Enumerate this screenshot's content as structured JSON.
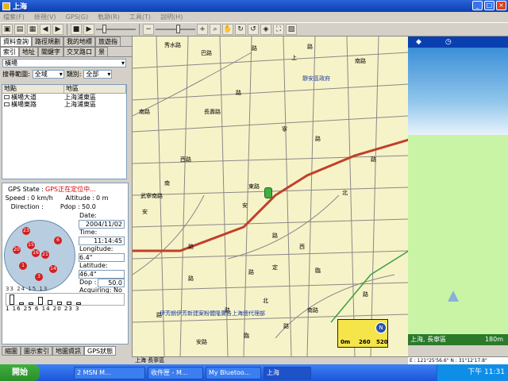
{
  "window": {
    "title": "上海"
  },
  "menu": [
    "檔案(F)",
    "檢視(V)",
    "GPS(G)",
    "軌跡(R)",
    "工具(T)",
    "說明(H)"
  ],
  "toolbar_icons": [
    "open-icon",
    "save-icon",
    "print-icon",
    "back-icon",
    "forward-icon",
    "stop-icon",
    "play-icon",
    "zoom-out-icon",
    "zoom-in-icon",
    "search-icon",
    "hand-icon",
    "rotate-icon"
  ],
  "left": {
    "tabs_top": [
      "資料查詢",
      "路徑規劃",
      "我的地標",
      "旅遊指"
    ],
    "tabs_sub": [
      "索引",
      "地址",
      "關鍵字",
      "交叉路口",
      "景"
    ],
    "category_select": "橫場",
    "search_range_label": "搜尋範圍:",
    "search_range_value": "全域",
    "type_label": "類別:",
    "type_value": "全部",
    "list_columns": [
      "地點",
      "地區"
    ],
    "list_rows": [
      {
        "name": "橫場大道",
        "area": "上海浦東區"
      },
      {
        "name": "橫場東路",
        "area": "上海浦東區"
      }
    ]
  },
  "gps": {
    "state_label": "GPS State :",
    "state_value": "GPS正在定位中...",
    "speed_label": "Speed :",
    "speed_value": "0 km/h",
    "altitude_label": "Altitude :",
    "altitude_value": "0 m",
    "direction_label": "Direction :",
    "pdop_label": "Pdop :",
    "pdop_value": "50.0",
    "date_label": "Date:",
    "date_value": "2004/11/02",
    "time_label": "Time:",
    "time_value": "11:14:45",
    "longitude_label": "Longitude:",
    "longitude_value": "6.4\"",
    "latitude_label": "Latitude:",
    "latitude_value": "46.4\"",
    "dop_label": "Dop :",
    "dop_value": "50.0",
    "acquiring_label": "Acquiring: No",
    "satellites": [
      "23",
      "6",
      "20",
      "16",
      "21",
      "15",
      "14",
      "3",
      "1"
    ],
    "bar_top_nums": "33 24   15   13",
    "bar_bottom_nums": "1 16 25  6 14 20 23  3",
    "signal_levels": [
      0.9,
      0.2,
      0.2,
      0.7,
      0.4,
      0.3,
      0.3,
      0.2
    ]
  },
  "bottom_tabs": [
    "縮圖",
    "圖示索引",
    "地圖資訊",
    "GPS狀態"
  ],
  "map": {
    "road_labels": [
      "秀水路",
      "巴路",
      "路",
      "路",
      "南路",
      "上",
      "南路",
      "長壽路",
      "武寧南路",
      "西路",
      "安",
      "路",
      "北",
      "路",
      "南",
      "臨",
      "路",
      "寧",
      "路",
      "東路",
      "定",
      "路",
      "路",
      "西",
      "路",
      "北",
      "路",
      "南路",
      "安",
      "路",
      "安路",
      "路",
      "臨",
      "路",
      "路",
      "巷",
      "寧",
      "路",
      "南路",
      "西路",
      "宜",
      "路",
      "北路",
      "臨",
      "路",
      "東路",
      "南",
      "路",
      "安",
      "路",
      "路",
      "中路",
      "寧",
      "路",
      "北",
      "路",
      "南",
      "路",
      "路",
      "中寧路",
      "湖南路",
      "安",
      "路",
      "路",
      "東路",
      "寧",
      "路",
      "路",
      "東路",
      "東",
      "路",
      "南",
      "路",
      "東路"
    ],
    "poi_labels": [
      "靜安區政府",
      "伊芳朗伊芳新建案粉體隆廣告上海總代理部"
    ],
    "scale_labels": [
      "0m",
      "260",
      "520"
    ],
    "status": "上海 長寧區"
  },
  "right": {
    "road_name": "上海, 長寧區",
    "distance": "180m",
    "coord": "E : 121°25'56.6\"  N : 31°12'17.8\""
  },
  "taskbar": {
    "start": "開始",
    "tasks": [
      "2 MSN M...",
      "收件匣 - M...",
      "My Bluetoo...",
      "上海"
    ],
    "clock": "下午 11:31"
  }
}
